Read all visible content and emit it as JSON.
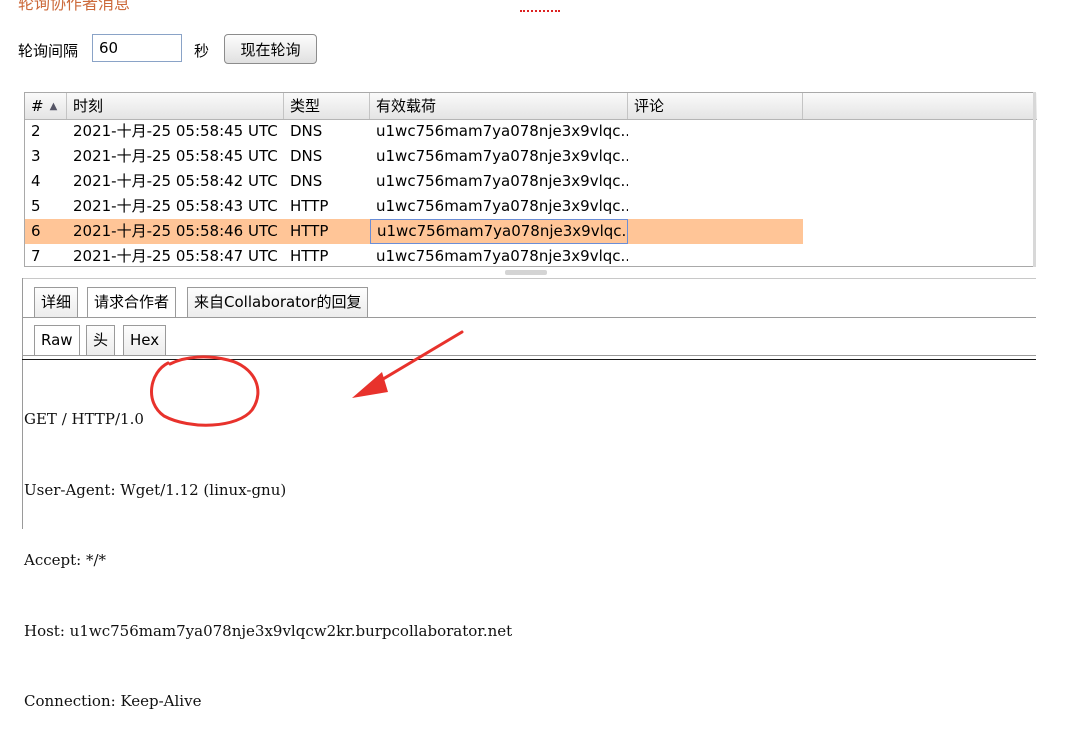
{
  "top_cut_heading": "轮询协作者消息",
  "poll": {
    "interval_label": "轮询间隔",
    "interval_value": "60",
    "unit_label": "秒",
    "poll_now_button": "现在轮询"
  },
  "table": {
    "columns": [
      "#",
      "时刻",
      "类型",
      "有效载荷",
      "评论"
    ],
    "sort_column": "#",
    "sort_direction": "ascending",
    "rows": [
      {
        "num": "2",
        "time": "2021-十月-25 05:58:45 UTC",
        "type": "DNS",
        "payload": "u1wc756mam7ya078nje3x9vlqc...",
        "comment": ""
      },
      {
        "num": "3",
        "time": "2021-十月-25 05:58:45 UTC",
        "type": "DNS",
        "payload": "u1wc756mam7ya078nje3x9vlqc...",
        "comment": ""
      },
      {
        "num": "4",
        "time": "2021-十月-25 05:58:42 UTC",
        "type": "DNS",
        "payload": "u1wc756mam7ya078nje3x9vlqc...",
        "comment": ""
      },
      {
        "num": "5",
        "time": "2021-十月-25 05:58:43 UTC",
        "type": "HTTP",
        "payload": "u1wc756mam7ya078nje3x9vlqc...",
        "comment": ""
      },
      {
        "num": "6",
        "time": "2021-十月-25 05:58:46 UTC",
        "type": "HTTP",
        "payload": "u1wc756mam7ya078nje3x9vlqc...",
        "comment": "",
        "selected": true
      },
      {
        "num": "7",
        "time": "2021-十月-25 05:58:47 UTC",
        "type": "HTTP",
        "payload": "u1wc756mam7ya078nje3x9vlqc...",
        "comment": ""
      }
    ]
  },
  "outer_tabs": [
    {
      "label": "详细",
      "active": false
    },
    {
      "label": "请求合作者",
      "active": true
    },
    {
      "label": "来自Collaborator的回复",
      "active": false
    }
  ],
  "inner_tabs": [
    {
      "label": "Raw",
      "active": true
    },
    {
      "label": "头",
      "active": false
    },
    {
      "label": "Hex",
      "active": false
    }
  ],
  "raw_request": {
    "lines": [
      "GET / HTTP/1.0",
      "User-Agent: Wget/1.12 (linux-gnu)",
      "Accept: */*",
      "Host: u1wc756mam7ya078nje3x9vlqcw2kr.burpcollaborator.net",
      "Connection: Keep-Alive"
    ]
  },
  "colors": {
    "selected_row": "#ffc597",
    "annotation_red": "#e8322c",
    "focus_border": "#6b8ed6"
  }
}
